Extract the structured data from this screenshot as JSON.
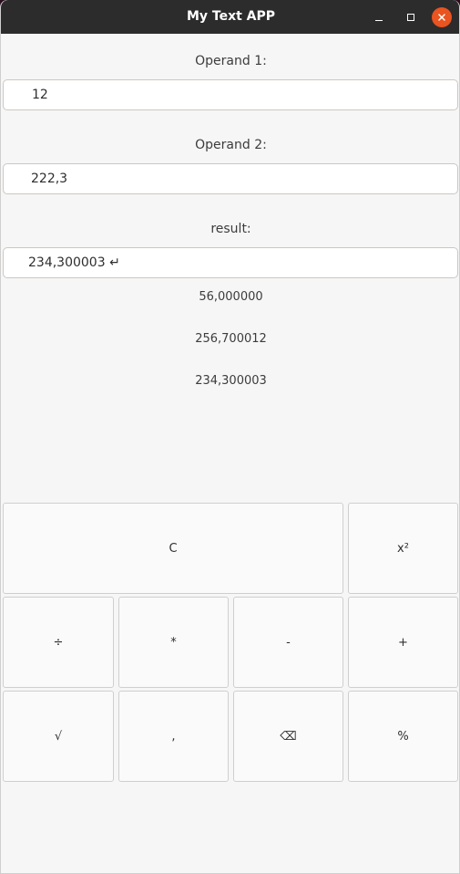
{
  "window": {
    "title": "My Text APP"
  },
  "operand1": {
    "label": "Operand 1:",
    "value": "12"
  },
  "operand2": {
    "label": "Operand 2:",
    "value": "222,3"
  },
  "result": {
    "label": "result:",
    "value": "234,300003 ↵"
  },
  "history": [
    "56,000000",
    "256,700012",
    "234,300003"
  ],
  "keys": {
    "clear": "C",
    "square": "x²",
    "divide": "÷",
    "multiply": "*",
    "subtract": "-",
    "add": "+",
    "sqrt": "√",
    "comma": ",",
    "backspace": "⌫",
    "percent": "%"
  },
  "colors": {
    "titlebar": "#2c2c2c",
    "close_button": "#e95420",
    "window_bg": "#f6f6f6"
  }
}
